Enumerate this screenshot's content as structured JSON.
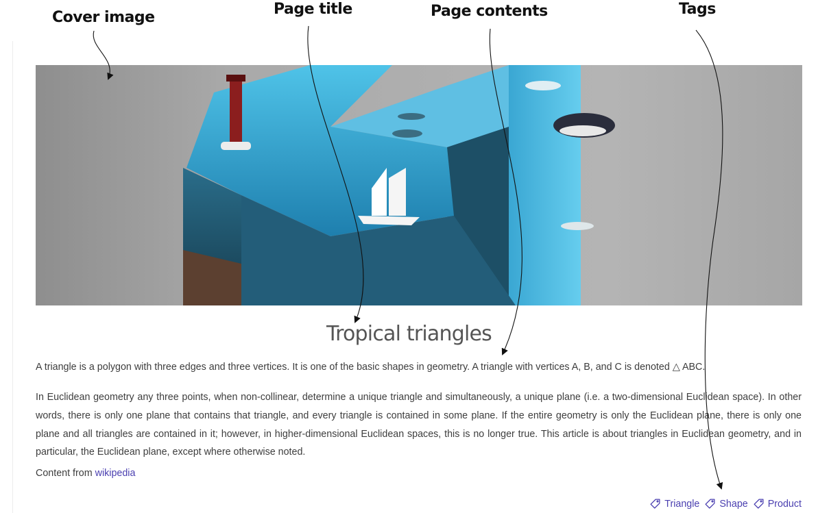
{
  "annotations": {
    "cover_image": "Cover image",
    "page_title": "Page title",
    "page_contents": "Page contents",
    "tags": "Tags"
  },
  "cover": {
    "icon": "cover-image"
  },
  "page": {
    "title": "Tropical triangles",
    "paragraphs": [
      "A triangle is a polygon with three edges and three vertices. It is one of the basic shapes in geometry. A triangle with vertices A, B, and C is denoted △ ABC.",
      "In Euclidean geometry any three points, when non-collinear, determine a unique triangle and simultaneously, a unique plane (i.e. a two-dimensional Euclidean space). In other words, there is only one plane that contains that triangle, and every triangle is contained in some plane. If the entire geometry is only the Euclidean plane, there is only one plane and all triangles are contained in it; however, in higher-dimensional Euclidean spaces, this is no longer true. This article is about triangles in Euclidean geometry, and in particular, the Euclidean plane, except where otherwise noted."
    ],
    "source_prefix": "Content from",
    "source_link": "wikipedia"
  },
  "tags": [
    {
      "label": "Triangle",
      "icon": "tag-icon"
    },
    {
      "label": "Shape",
      "icon": "tag-icon"
    },
    {
      "label": "Product",
      "icon": "tag-icon"
    }
  ],
  "colors": {
    "link": "#4a3fb0",
    "text": "#3d3d3d",
    "title": "#555555"
  }
}
